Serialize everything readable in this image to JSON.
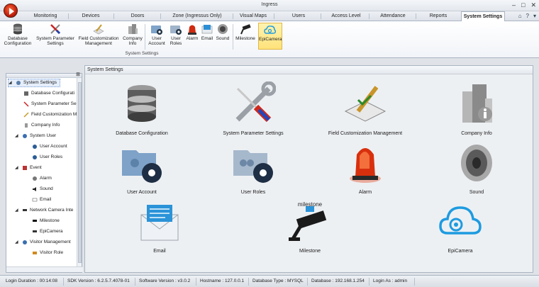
{
  "window": {
    "title": "Ingress"
  },
  "tabs": [
    "Monitoring",
    "Devices",
    "Doors",
    "Zone (Ingressus Only)",
    "Visual Maps",
    "Users",
    "Access Level",
    "Attendance",
    "Reports",
    "System Settings"
  ],
  "ribbon": {
    "group_label": "System Settings",
    "buttons": [
      {
        "label": "Database Configuration",
        "icon": "database-icon"
      },
      {
        "label": "System Parameter Settings",
        "icon": "wrench-screwdriver-icon"
      },
      {
        "label": "Field Customization Management",
        "icon": "field-edit-icon"
      },
      {
        "label": "Company Info",
        "icon": "building-icon"
      },
      {
        "label": "User Account",
        "icon": "user-folder-icon"
      },
      {
        "label": "User Roles",
        "icon": "roles-folder-icon"
      },
      {
        "label": "Alarm",
        "icon": "alarm-light-icon"
      },
      {
        "label": "Email",
        "icon": "email-icon"
      },
      {
        "label": "Sound",
        "icon": "speaker-icon"
      },
      {
        "label": "Milestone",
        "icon": "milestone-camera-icon"
      },
      {
        "label": "EpiCamera",
        "icon": "cloud-camera-icon"
      }
    ]
  },
  "tree": {
    "root": "System Settings",
    "items": [
      {
        "label": "Database Configurati",
        "level": 1
      },
      {
        "label": "System Parameter Se",
        "level": 1
      },
      {
        "label": "Field Customization M",
        "level": 1
      },
      {
        "label": "Company Info",
        "level": 1
      },
      {
        "label": "System User",
        "level": 1
      },
      {
        "label": "User Account",
        "level": 2
      },
      {
        "label": "User Roles",
        "level": 2
      },
      {
        "label": "Event",
        "level": 1
      },
      {
        "label": "Alarm",
        "level": 2
      },
      {
        "label": "Sound",
        "level": 2
      },
      {
        "label": "Email",
        "level": 2
      },
      {
        "label": "Network Camera Inte",
        "level": 1
      },
      {
        "label": "Milestone",
        "level": 2
      },
      {
        "label": "EpiCamera",
        "level": 2
      },
      {
        "label": "Visitor Management",
        "level": 1
      },
      {
        "label": "Visitor Role",
        "level": 2
      }
    ]
  },
  "main": {
    "header": "System Settings",
    "tiles": [
      "Database Configuration",
      "System Parameter Settings",
      "Field Customization Management",
      "Company Info",
      "User Account",
      "User Roles",
      "Alarm",
      "Sound",
      "Email",
      "Milestone",
      "EpiCamera"
    ],
    "milestone_logo_text": "milestone"
  },
  "status": {
    "login_duration": "Login Duration : 00:14:08",
    "sdk_version": "SDK Version : 6.2.5.7.4078-01",
    "software_version": "Software Version : v3.0.2",
    "hostname": "Hostname : 127.0.0.1",
    "database_type": "Database Type : MYSQL",
    "database": "Database : 192.168.1.254",
    "login_as": "Login As : admin"
  }
}
